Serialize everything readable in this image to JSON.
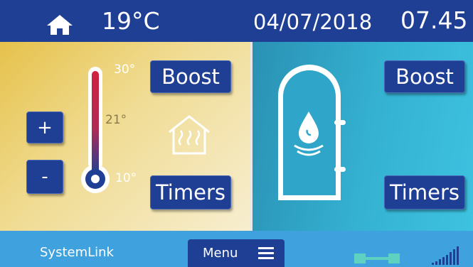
{
  "header": {
    "home_icon": "home-icon",
    "temperature": "19°C",
    "date": "04/07/2018",
    "time": "07.45"
  },
  "heating": {
    "plus_label": "+",
    "minus_label": "-",
    "boost_label": "Boost",
    "timers_label": "Timers",
    "thermometer": {
      "max": "30°",
      "current": "21°",
      "min": "10°"
    },
    "icons": [
      "thermometer-icon",
      "house-heating-icon"
    ]
  },
  "hot_water": {
    "boost_label": "Boost",
    "timers_label": "Timers",
    "icons": [
      "water-tank-icon",
      "water-drop-icon"
    ]
  },
  "footer": {
    "brand": "SystemLink",
    "menu_label": "Menu",
    "icons": [
      "menu-icon",
      "connection-icon",
      "signal-strength-icon"
    ]
  },
  "colors": {
    "header_bg": "#1f3f95",
    "button_bg": "#1f3f95",
    "footer_bg": "#3fa1dd",
    "heating_gradient_start": "#e6c24c",
    "water_gradient_end": "#3dc2e0",
    "thermometer_red": "#d0213f"
  }
}
